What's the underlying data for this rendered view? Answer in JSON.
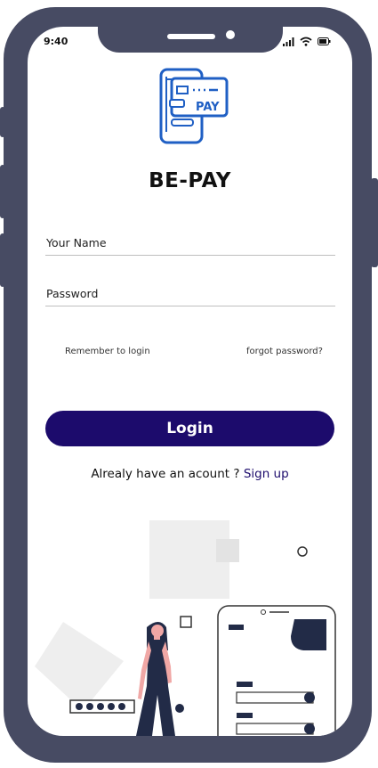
{
  "status_bar": {
    "time": "9:40"
  },
  "app": {
    "title": "BE-PAY",
    "logo_text": "PAY"
  },
  "form": {
    "name_placeholder": "Your Name",
    "password_placeholder": "Password",
    "remember_label": "Remember to login",
    "forgot_label": "forgot password?",
    "login_label": "Login"
  },
  "signup": {
    "prompt": "Alrealy have an acount  ? ",
    "link": "Sign up"
  },
  "colors": {
    "primary": "#1c0b6c",
    "frame": "#474b63",
    "logo": "#1f5fc4"
  }
}
